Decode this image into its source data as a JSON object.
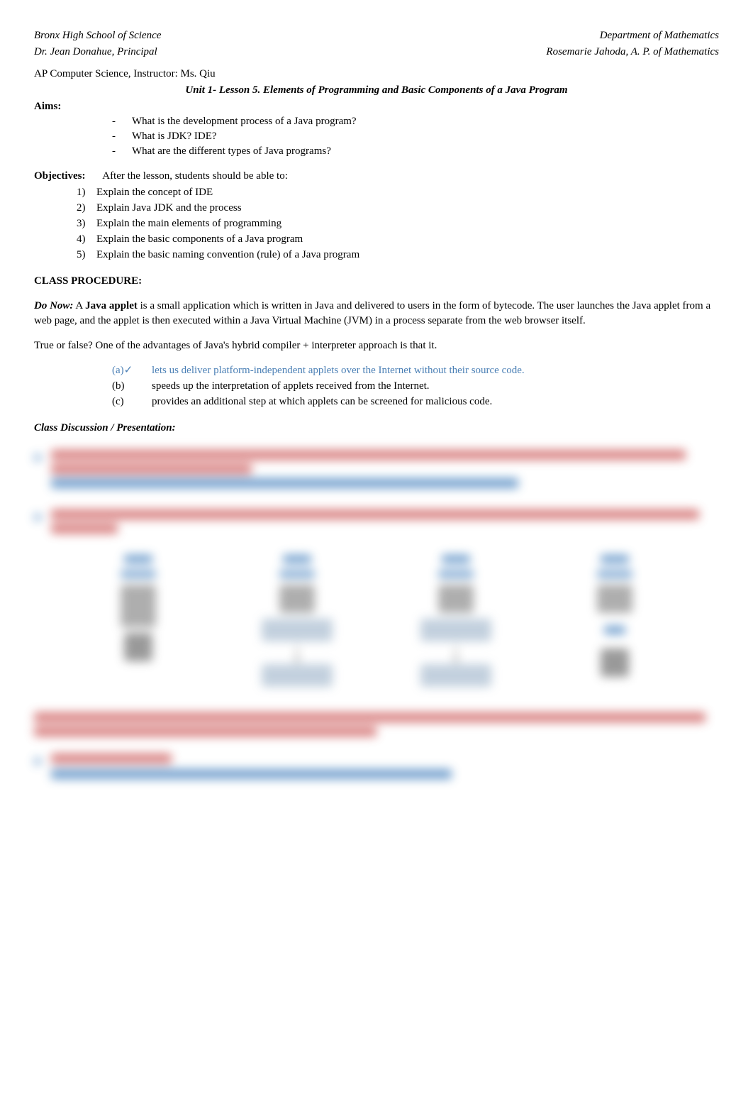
{
  "header": {
    "school_left": "Bronx High School of Science",
    "dept_right": "Department of Mathematics",
    "principal_left": "Dr. Jean Donahue, Principal",
    "ap_right": "Rosemarie Jahoda, A. P. of Mathematics"
  },
  "course_line": "AP Computer Science, Instructor: Ms. Qiu",
  "unit_title": "Unit 1- Lesson 5. Elements of Programming and Basic Components of a Java Program",
  "aims": {
    "label": "Aims:",
    "items": [
      "What is the development process of a Java program?",
      "What is JDK? IDE?",
      "What are the different types of Java programs?"
    ]
  },
  "objectives": {
    "label": "Objectives:",
    "intro": "After the lesson, students should be able to:",
    "items": [
      "Explain the concept of IDE",
      "Explain Java JDK and the process",
      "Explain the main elements of programming",
      "Explain the basic components of a Java program",
      "Explain the basic naming convention (rule) of a Java program"
    ]
  },
  "class_procedure": "CLASS PROCEDURE:",
  "do_now": {
    "label": "Do Now:",
    "intro_a": "A ",
    "applet": "Java applet",
    "text": " is a small application which is written in Java and delivered to users in the form of bytecode. The user launches the Java applet from a web page, and the applet is then executed within a Java Virtual Machine (JVM) in a process separate from the web browser itself."
  },
  "tf_question": "True or false?  One of the advantages of Java's hybrid compiler + interpreter approach is that it.",
  "options": {
    "a_label": "(a)✓",
    "a_text": "lets us deliver platform-independent applets over the Internet without their source code.",
    "b_label": "(b)",
    "b_text": "speeds up the interpretation of applets received from the Internet.",
    "c_label": "(c)",
    "c_text": "provides an additional step at which applets can be screened for malicious code."
  },
  "class_discussion": "Class Discussion / Presentation:"
}
